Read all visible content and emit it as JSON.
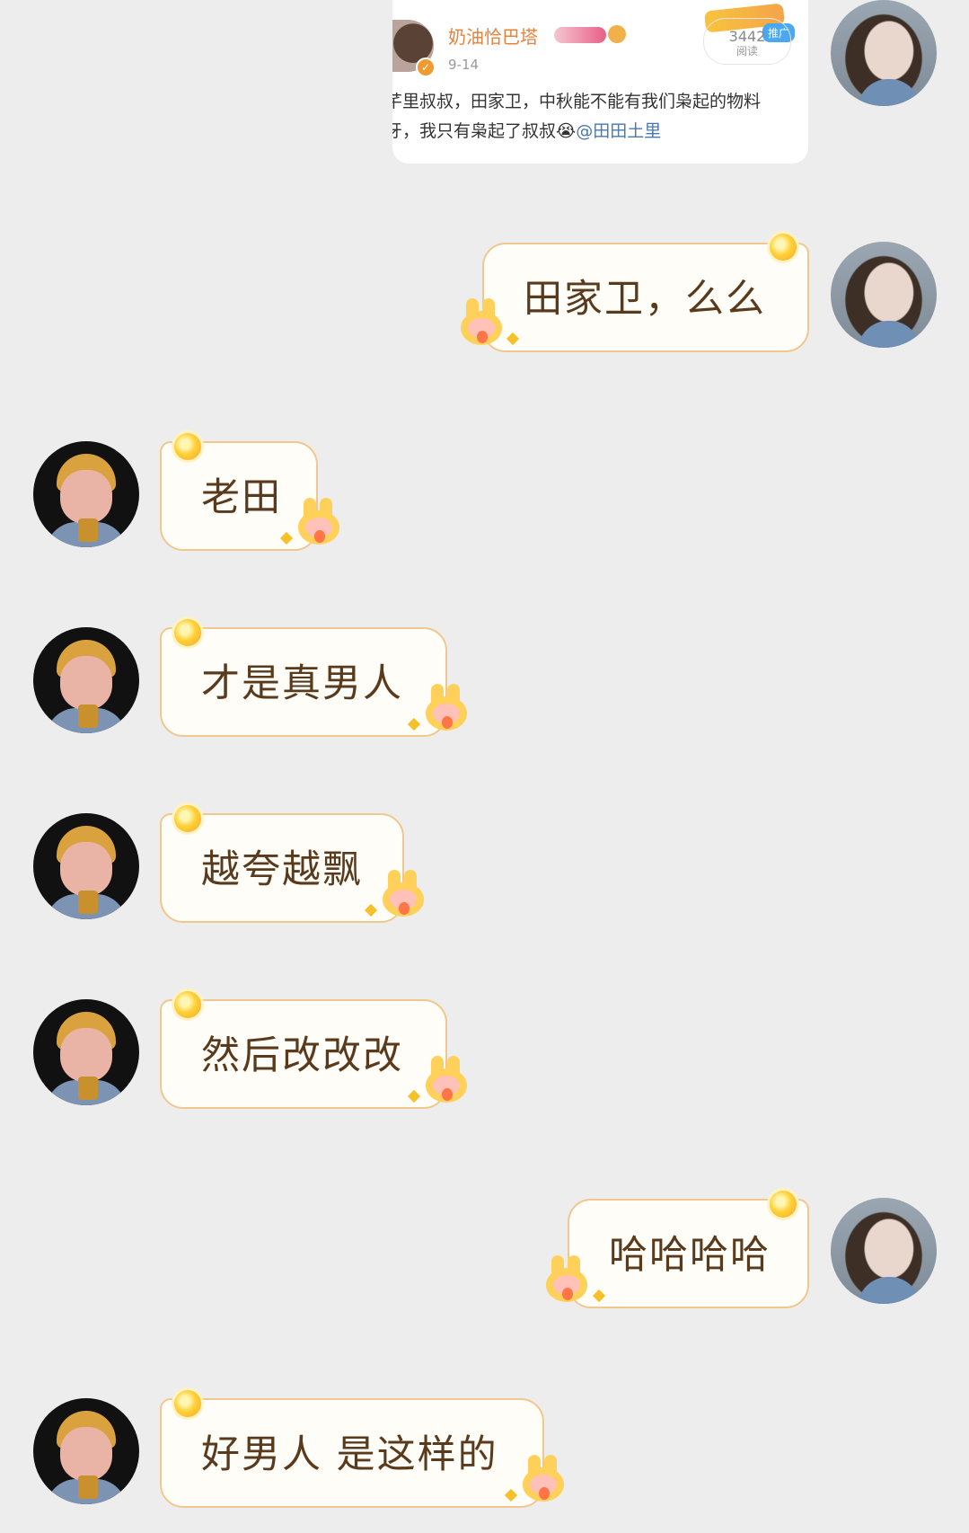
{
  "shared_post": {
    "author": "奶油恰巴塔",
    "date": "9-14",
    "read_count": "3442",
    "read_label": "阅读",
    "promo_label": "推广",
    "text_line_1": "芊里叔叔，田家卫，中秋能不能有我们枭起的物料",
    "text_line_2_prefix": "牙，我只有枭起了叔叔😭",
    "text_line_2_mention": "@田田土里"
  },
  "messages": [
    {
      "side": "right",
      "sender": "girl",
      "text": "田家卫，么么"
    },
    {
      "side": "left",
      "sender": "man",
      "text": "老田"
    },
    {
      "side": "left",
      "sender": "man",
      "text": "才是真男人"
    },
    {
      "side": "left",
      "sender": "man",
      "text": "越夸越飘"
    },
    {
      "side": "left",
      "sender": "man",
      "text": "然后改改改"
    },
    {
      "side": "right",
      "sender": "girl",
      "text": "哈哈哈哈"
    },
    {
      "side": "left",
      "sender": "man",
      "text": "好男人 是这样的"
    }
  ],
  "colors": {
    "background": "#ededed",
    "bubble_fill": "#fffdf7",
    "bubble_border": "#f0c78f",
    "bubble_text": "#5a3a1d",
    "author_name": "#e8823a",
    "mention": "#4a78b0"
  },
  "icons": [
    "verified-badge-icon",
    "level-badge-icon",
    "sun-sticker-icon",
    "bunny-sticker-icon",
    "sparkle-icon"
  ]
}
